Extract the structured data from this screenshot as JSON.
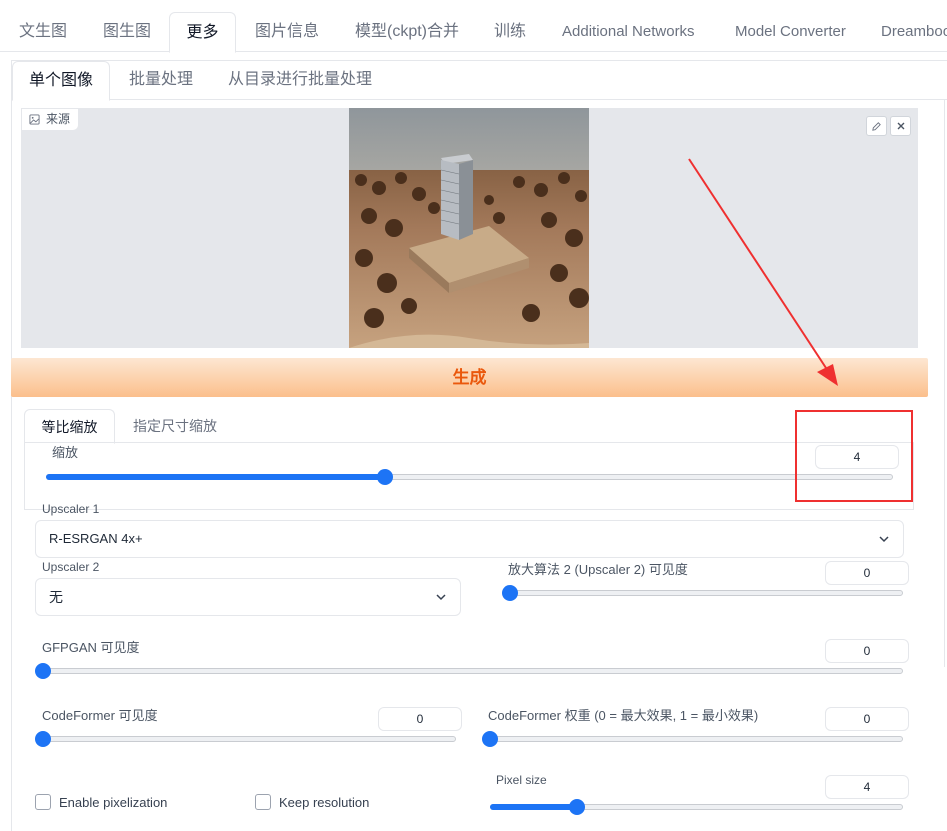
{
  "top_tabs": [
    "文生图",
    "图生图",
    "更多",
    "图片信息",
    "模型(ckpt)合并",
    "训练",
    "Additional Networks",
    "Model Converter",
    "Dreambooth"
  ],
  "sub_tabs": [
    "单个图像",
    "批量处理",
    "从目录进行批量处理"
  ],
  "image_source": {
    "label": "来源"
  },
  "generate_label": "生成",
  "resize_tabs": [
    "等比缩放",
    "指定尺寸缩放"
  ],
  "scale": {
    "label": "缩放",
    "value": "4",
    "fraction": 0.4
  },
  "upscaler1": {
    "label": "Upscaler 1",
    "value": "R-ESRGAN 4x+"
  },
  "upscaler2": {
    "label": "Upscaler 2",
    "value": "无"
  },
  "upscaler2_visibility": {
    "label": "放大算法 2 (Upscaler 2) 可见度",
    "value": "0",
    "fraction": 0
  },
  "gfpgan": {
    "label": "GFPGAN 可见度",
    "value": "0",
    "fraction": 0
  },
  "codeformer_visibility": {
    "label": "CodeFormer 可见度",
    "value": "0",
    "fraction": 0
  },
  "codeformer_weight": {
    "label": "CodeFormer 权重 (0 = 最大效果, 1 = 最小效果)",
    "value": "0",
    "fraction": 0
  },
  "pixel_size": {
    "label": "Pixel size",
    "value": "4",
    "fraction": 0.21
  },
  "checkboxes": {
    "pixelization": "Enable pixelization",
    "keep_resolution": "Keep resolution"
  },
  "colors": {
    "accent": "#1d74f5",
    "generate": "#ea580c",
    "annotation": "#ef3030"
  }
}
